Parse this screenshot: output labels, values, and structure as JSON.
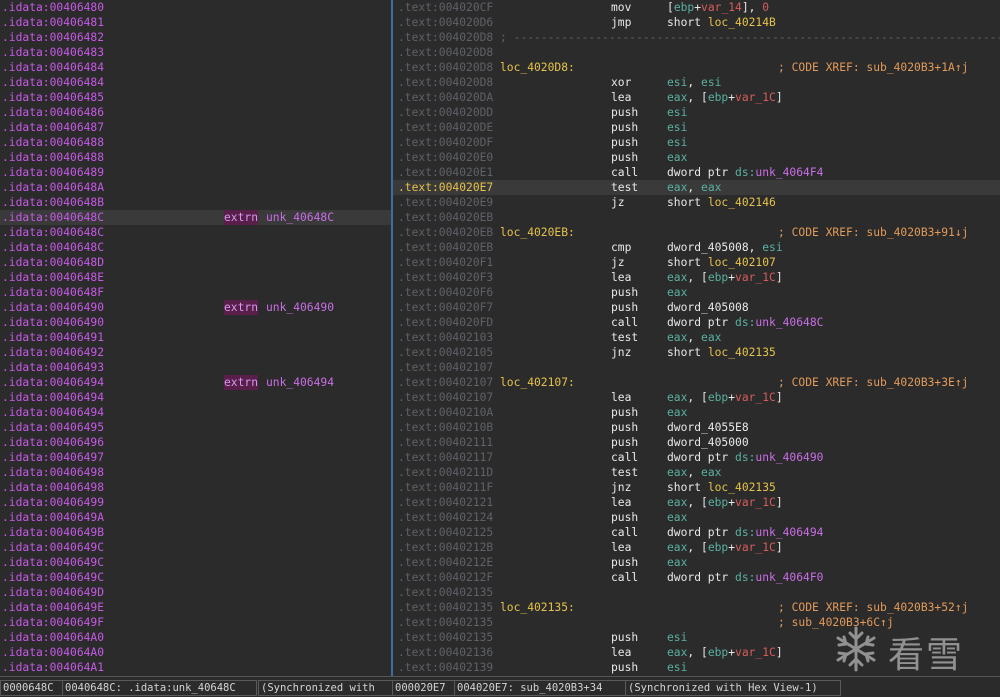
{
  "left_pane": [
    {
      "addr": ".idata:00406480"
    },
    {
      "addr": ".idata:00406481"
    },
    {
      "addr": ".idata:00406482"
    },
    {
      "addr": ".idata:00406483"
    },
    {
      "addr": ".idata:00406484"
    },
    {
      "addr": ".idata:00406484"
    },
    {
      "addr": ".idata:00406485"
    },
    {
      "addr": ".idata:00406486"
    },
    {
      "addr": ".idata:00406487"
    },
    {
      "addr": ".idata:00406488"
    },
    {
      "addr": ".idata:00406488"
    },
    {
      "addr": ".idata:00406489"
    },
    {
      "addr": ".idata:0040648A"
    },
    {
      "addr": ".idata:0040648B"
    },
    {
      "addr": ".idata:0040648C",
      "current": true,
      "kw": "extrn",
      "name": "unk_40648C"
    },
    {
      "addr": ".idata:0040648C"
    },
    {
      "addr": ".idata:0040648C"
    },
    {
      "addr": ".idata:0040648D"
    },
    {
      "addr": ".idata:0040648E"
    },
    {
      "addr": ".idata:0040648F"
    },
    {
      "addr": ".idata:00406490",
      "kw": "extrn",
      "name": "unk_406490"
    },
    {
      "addr": ".idata:00406490"
    },
    {
      "addr": ".idata:00406491"
    },
    {
      "addr": ".idata:00406492"
    },
    {
      "addr": ".idata:00406493"
    },
    {
      "addr": ".idata:00406494",
      "kw": "extrn",
      "name": "unk_406494"
    },
    {
      "addr": ".idata:00406494"
    },
    {
      "addr": ".idata:00406494"
    },
    {
      "addr": ".idata:00406495"
    },
    {
      "addr": ".idata:00406496"
    },
    {
      "addr": ".idata:00406497"
    },
    {
      "addr": ".idata:00406498"
    },
    {
      "addr": ".idata:00406498"
    },
    {
      "addr": ".idata:00406499"
    },
    {
      "addr": ".idata:0040649A"
    },
    {
      "addr": ".idata:0040649B"
    },
    {
      "addr": ".idata:0040649C"
    },
    {
      "addr": ".idata:0040649C"
    },
    {
      "addr": ".idata:0040649C"
    },
    {
      "addr": ".idata:0040649D"
    },
    {
      "addr": ".idata:0040649E"
    },
    {
      "addr": ".idata:0040649F"
    },
    {
      "addr": ".idata:004064A0"
    },
    {
      "addr": ".idata:004064A0"
    },
    {
      "addr": ".idata:004064A1"
    }
  ],
  "right_pane": [
    {
      "addr": ".text:004020CF",
      "mnem": "mov",
      "ops": [
        {
          "t": "[",
          "c": "t-plain"
        },
        {
          "t": "ebp",
          "c": "t-reg"
        },
        {
          "t": "+",
          "c": "t-plain"
        },
        {
          "t": "var_14",
          "c": "t-var"
        },
        {
          "t": "], ",
          "c": "t-plain"
        },
        {
          "t": "0",
          "c": "t-num"
        }
      ]
    },
    {
      "addr": ".text:004020D6",
      "mnem": "jmp",
      "ops": [
        {
          "t": "short ",
          "c": "t-kw"
        },
        {
          "t": "loc_40214B",
          "c": "t-name"
        }
      ]
    },
    {
      "addr": ".text:004020D8",
      "sep": "; ---------------------------------------------------------------------------"
    },
    {
      "addr": ".text:004020D8"
    },
    {
      "addr": ".text:004020D8",
      "label": "loc_4020D8:",
      "cmt": "; CODE XREF: sub_4020B3+1A↑j"
    },
    {
      "addr": ".text:004020D8",
      "mnem": "xor",
      "ops": [
        {
          "t": "esi",
          "c": "t-reg"
        },
        {
          "t": ", ",
          "c": "t-plain"
        },
        {
          "t": "esi",
          "c": "t-reg"
        }
      ]
    },
    {
      "addr": ".text:004020DA",
      "mnem": "lea",
      "ops": [
        {
          "t": "eax",
          "c": "t-reg"
        },
        {
          "t": ", [",
          "c": "t-plain"
        },
        {
          "t": "ebp",
          "c": "t-reg"
        },
        {
          "t": "+",
          "c": "t-plain"
        },
        {
          "t": "var_1C",
          "c": "t-var"
        },
        {
          "t": "]",
          "c": "t-plain"
        }
      ]
    },
    {
      "addr": ".text:004020DD",
      "mnem": "push",
      "ops": [
        {
          "t": "esi",
          "c": "t-reg"
        }
      ]
    },
    {
      "addr": ".text:004020DE",
      "mnem": "push",
      "ops": [
        {
          "t": "esi",
          "c": "t-reg"
        }
      ]
    },
    {
      "addr": ".text:004020DF",
      "mnem": "push",
      "ops": [
        {
          "t": "esi",
          "c": "t-reg"
        }
      ]
    },
    {
      "addr": ".text:004020E0",
      "mnem": "push",
      "ops": [
        {
          "t": "eax",
          "c": "t-reg"
        }
      ]
    },
    {
      "addr": ".text:004020E1",
      "mnem": "call",
      "ops": [
        {
          "t": "dword ptr ",
          "c": "t-kw"
        },
        {
          "t": "ds:",
          "c": "t-reg"
        },
        {
          "t": "unk_4064F4",
          "c": "t-sym"
        }
      ]
    },
    {
      "addr": ".text:004020E7",
      "current": true,
      "mnem": "test",
      "ops": [
        {
          "t": "eax",
          "c": "t-reg"
        },
        {
          "t": ", ",
          "c": "t-plain"
        },
        {
          "t": "eax",
          "c": "t-reg"
        }
      ]
    },
    {
      "addr": ".text:004020E9",
      "mnem": "jz",
      "ops": [
        {
          "t": "short ",
          "c": "t-kw"
        },
        {
          "t": "loc_402146",
          "c": "t-name"
        }
      ]
    },
    {
      "addr": ".text:004020EB"
    },
    {
      "addr": ".text:004020EB",
      "label": "loc_4020EB:",
      "cmt": "; CODE XREF: sub_4020B3+91↓j"
    },
    {
      "addr": ".text:004020EB",
      "mnem": "cmp",
      "ops": [
        {
          "t": "dword_405008",
          "c": "t-kw"
        },
        {
          "t": ", ",
          "c": "t-plain"
        },
        {
          "t": "esi",
          "c": "t-reg"
        }
      ]
    },
    {
      "addr": ".text:004020F1",
      "mnem": "jz",
      "ops": [
        {
          "t": "short ",
          "c": "t-kw"
        },
        {
          "t": "loc_402107",
          "c": "t-name"
        }
      ]
    },
    {
      "addr": ".text:004020F3",
      "mnem": "lea",
      "ops": [
        {
          "t": "eax",
          "c": "t-reg"
        },
        {
          "t": ", [",
          "c": "t-plain"
        },
        {
          "t": "ebp",
          "c": "t-reg"
        },
        {
          "t": "+",
          "c": "t-plain"
        },
        {
          "t": "var_1C",
          "c": "t-var"
        },
        {
          "t": "]",
          "c": "t-plain"
        }
      ]
    },
    {
      "addr": ".text:004020F6",
      "mnem": "push",
      "ops": [
        {
          "t": "eax",
          "c": "t-reg"
        }
      ]
    },
    {
      "addr": ".text:004020F7",
      "mnem": "push",
      "ops": [
        {
          "t": "dword_405008",
          "c": "t-kw"
        }
      ]
    },
    {
      "addr": ".text:004020FD",
      "mnem": "call",
      "ops": [
        {
          "t": "dword ptr ",
          "c": "t-kw"
        },
        {
          "t": "ds:",
          "c": "t-reg"
        },
        {
          "t": "unk_40648C",
          "c": "t-sym"
        }
      ]
    },
    {
      "addr": ".text:00402103",
      "mnem": "test",
      "ops": [
        {
          "t": "eax",
          "c": "t-reg"
        },
        {
          "t": ", ",
          "c": "t-plain"
        },
        {
          "t": "eax",
          "c": "t-reg"
        }
      ]
    },
    {
      "addr": ".text:00402105",
      "mnem": "jnz",
      "ops": [
        {
          "t": "short ",
          "c": "t-kw"
        },
        {
          "t": "loc_402135",
          "c": "t-name"
        }
      ]
    },
    {
      "addr": ".text:00402107"
    },
    {
      "addr": ".text:00402107",
      "label": "loc_402107:",
      "cmt": "; CODE XREF: sub_4020B3+3E↑j"
    },
    {
      "addr": ".text:00402107",
      "mnem": "lea",
      "ops": [
        {
          "t": "eax",
          "c": "t-reg"
        },
        {
          "t": ", [",
          "c": "t-plain"
        },
        {
          "t": "ebp",
          "c": "t-reg"
        },
        {
          "t": "+",
          "c": "t-plain"
        },
        {
          "t": "var_1C",
          "c": "t-var"
        },
        {
          "t": "]",
          "c": "t-plain"
        }
      ]
    },
    {
      "addr": ".text:0040210A",
      "mnem": "push",
      "ops": [
        {
          "t": "eax",
          "c": "t-reg"
        }
      ]
    },
    {
      "addr": ".text:0040210B",
      "mnem": "push",
      "ops": [
        {
          "t": "dword_4055E8",
          "c": "t-kw"
        }
      ]
    },
    {
      "addr": ".text:00402111",
      "mnem": "push",
      "ops": [
        {
          "t": "dword_405000",
          "c": "t-kw"
        }
      ]
    },
    {
      "addr": ".text:00402117",
      "mnem": "call",
      "ops": [
        {
          "t": "dword ptr ",
          "c": "t-kw"
        },
        {
          "t": "ds:",
          "c": "t-reg"
        },
        {
          "t": "unk_406490",
          "c": "t-sym"
        }
      ]
    },
    {
      "addr": ".text:0040211D",
      "mnem": "test",
      "ops": [
        {
          "t": "eax",
          "c": "t-reg"
        },
        {
          "t": ", ",
          "c": "t-plain"
        },
        {
          "t": "eax",
          "c": "t-reg"
        }
      ]
    },
    {
      "addr": ".text:0040211F",
      "mnem": "jnz",
      "ops": [
        {
          "t": "short ",
          "c": "t-kw"
        },
        {
          "t": "loc_402135",
          "c": "t-name"
        }
      ]
    },
    {
      "addr": ".text:00402121",
      "mnem": "lea",
      "ops": [
        {
          "t": "eax",
          "c": "t-reg"
        },
        {
          "t": ", [",
          "c": "t-plain"
        },
        {
          "t": "ebp",
          "c": "t-reg"
        },
        {
          "t": "+",
          "c": "t-plain"
        },
        {
          "t": "var_1C",
          "c": "t-var"
        },
        {
          "t": "]",
          "c": "t-plain"
        }
      ]
    },
    {
      "addr": ".text:00402124",
      "mnem": "push",
      "ops": [
        {
          "t": "eax",
          "c": "t-reg"
        }
      ]
    },
    {
      "addr": ".text:00402125",
      "mnem": "call",
      "ops": [
        {
          "t": "dword ptr ",
          "c": "t-kw"
        },
        {
          "t": "ds:",
          "c": "t-reg"
        },
        {
          "t": "unk_406494",
          "c": "t-sym"
        }
      ]
    },
    {
      "addr": ".text:0040212B",
      "mnem": "lea",
      "ops": [
        {
          "t": "eax",
          "c": "t-reg"
        },
        {
          "t": ", [",
          "c": "t-plain"
        },
        {
          "t": "ebp",
          "c": "t-reg"
        },
        {
          "t": "+",
          "c": "t-plain"
        },
        {
          "t": "var_1C",
          "c": "t-var"
        },
        {
          "t": "]",
          "c": "t-plain"
        }
      ]
    },
    {
      "addr": ".text:0040212E",
      "mnem": "push",
      "ops": [
        {
          "t": "eax",
          "c": "t-reg"
        }
      ]
    },
    {
      "addr": ".text:0040212F",
      "mnem": "call",
      "ops": [
        {
          "t": "dword ptr ",
          "c": "t-kw"
        },
        {
          "t": "ds:",
          "c": "t-reg"
        },
        {
          "t": "unk_4064F0",
          "c": "t-sym"
        }
      ]
    },
    {
      "addr": ".text:00402135"
    },
    {
      "addr": ".text:00402135",
      "label": "loc_402135:",
      "cmt": "; CODE XREF: sub_4020B3+52↑j"
    },
    {
      "addr": ".text:00402135",
      "cmt": "; sub_4020B3+6C↑j"
    },
    {
      "addr": ".text:00402135",
      "mnem": "push",
      "ops": [
        {
          "t": "esi",
          "c": "t-reg"
        }
      ]
    },
    {
      "addr": ".text:00402136",
      "mnem": "lea",
      "ops": [
        {
          "t": "eax",
          "c": "t-reg"
        },
        {
          "t": ", [",
          "c": "t-plain"
        },
        {
          "t": "ebp",
          "c": "t-reg"
        },
        {
          "t": "+",
          "c": "t-plain"
        },
        {
          "t": "var_1C",
          "c": "t-var"
        },
        {
          "t": "]",
          "c": "t-plain"
        }
      ]
    },
    {
      "addr": ".text:00402139",
      "mnem": "push",
      "ops": [
        {
          "t": "esi",
          "c": "t-reg"
        }
      ]
    }
  ],
  "status_bar": {
    "left_offset": "0000648C",
    "left_location": "0040648C: .idata:unk_40648C",
    "left_sync": "(Synchronized with",
    "right_offset": "000020E7",
    "right_location": "004020E7: sub_4020B3+34",
    "right_sync": "(Synchronized with Hex View-1)"
  },
  "watermark": {
    "text": "看雪",
    "icon": "snowflake-icon"
  }
}
